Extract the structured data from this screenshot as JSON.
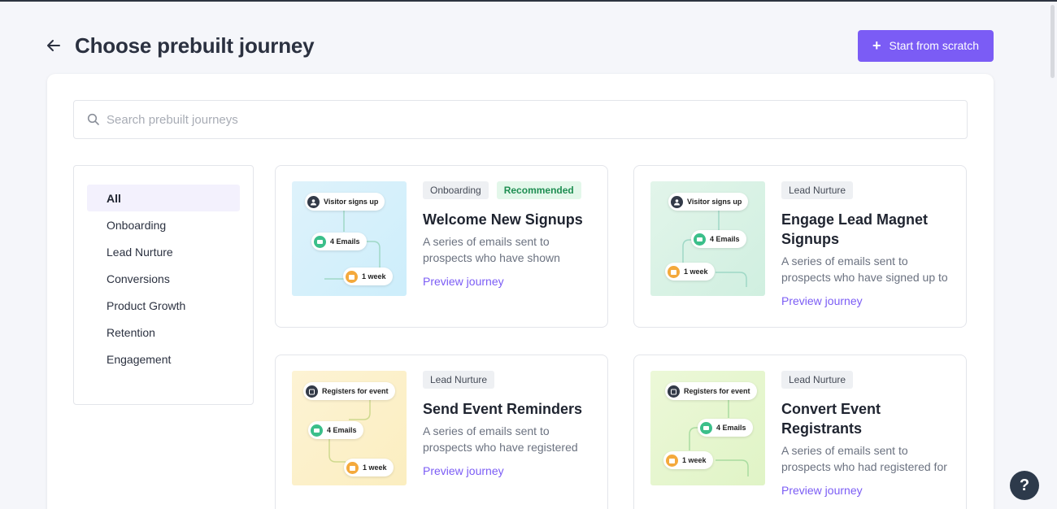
{
  "header": {
    "title": "Choose prebuilt journey",
    "start_label": "Start from scratch"
  },
  "search": {
    "placeholder": "Search prebuilt journeys"
  },
  "filters": [
    {
      "label": "All",
      "active": true
    },
    {
      "label": "Onboarding"
    },
    {
      "label": "Lead Nurture"
    },
    {
      "label": "Conversions"
    },
    {
      "label": "Product Growth"
    },
    {
      "label": "Retention"
    },
    {
      "label": "Engagement"
    }
  ],
  "cards": [
    {
      "tags": [
        "Onboarding",
        "Recommended"
      ],
      "title": "Welcome New Signups",
      "desc": "A series of emails sent to prospects who have shown",
      "preview": "Preview journey",
      "nodes": [
        "Visitor signs up",
        "4 Emails",
        "1 week"
      ]
    },
    {
      "tags": [
        "Lead Nurture"
      ],
      "title": "Engage Lead Magnet Signups",
      "desc": "A series of emails sent to prospects who have signed up to",
      "preview": "Preview journey",
      "nodes": [
        "Visitor signs up",
        "4 Emails",
        "1 week"
      ]
    },
    {
      "tags": [
        "Lead Nurture"
      ],
      "title": "Send Event Reminders",
      "desc": "A series of emails sent to prospects who have registered",
      "preview": "Preview journey",
      "nodes": [
        "Registers for event",
        "4 Emails",
        "1 week"
      ]
    },
    {
      "tags": [
        "Lead Nurture"
      ],
      "title": "Convert Event Registrants",
      "desc": "A series of emails sent to prospects who had registered for",
      "preview": "Preview journey",
      "nodes": [
        "Registers for event",
        "4 Emails",
        "1 week"
      ]
    }
  ],
  "help_label": "?",
  "colors": {
    "accent": "#7b5cf5",
    "recommended": "#1f8e52"
  }
}
